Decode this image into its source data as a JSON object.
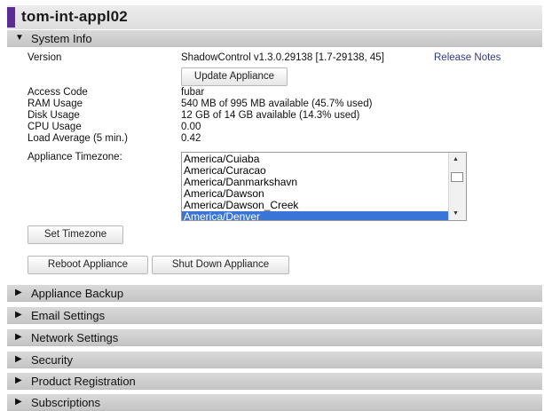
{
  "title": "tom-int-appl02",
  "system_info": {
    "header": "System Info",
    "rows": [
      {
        "label": "Version",
        "value": "ShadowControl v1.3.0.29138 [1.7-29138, 45]"
      },
      {
        "label": "Access Code",
        "value": "fubar"
      },
      {
        "label": "RAM Usage",
        "value": "540 MB of 995 MB available (45.7% used)"
      },
      {
        "label": "Disk Usage",
        "value": "12 GB of 14 GB available (14.3% used)"
      },
      {
        "label": "CPU Usage",
        "value": "0.00"
      },
      {
        "label": "Load Average (5 min.)",
        "value": "0.42"
      }
    ],
    "release_notes_label": "Release Notes",
    "update_button": "Update Appliance",
    "timezone_label": "Appliance Timezone:",
    "timezone_options": [
      "America/Cuiaba",
      "America/Curacao",
      "America/Danmarkshavn",
      "America/Dawson",
      "America/Dawson_Creek",
      "America/Denver"
    ],
    "timezone_selected": "America/Denver",
    "set_timezone_button": "Set Timezone",
    "reboot_button": "Reboot Appliance",
    "shutdown_button": "Shut Down Appliance"
  },
  "sections": [
    "Appliance Backup",
    "Email Settings",
    "Network Settings",
    "Security",
    "Product Registration",
    "Subscriptions"
  ],
  "icons": {
    "expanded": "triangle-down-icon",
    "collapsed": "triangle-right-icon"
  },
  "colors": {
    "accent": "#5c2d91",
    "link": "#2d3a8c",
    "selected": "#3875d7",
    "header_bg": "#d0d0d0"
  }
}
